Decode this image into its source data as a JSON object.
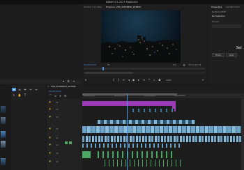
{
  "app": {
    "title": "BBNM 4-5-2023 MAKE4UA"
  },
  "source_panel": {
    "tabs": [
      "Source: (no clips)",
      "Program: V09_20180820_224502"
    ]
  },
  "program_monitor": {
    "timecode_left": "00;00;03;04",
    "fit": "Fit",
    "quality": "Full",
    "timecode_right": "00;12;04;18"
  },
  "properties_panel": {
    "tabs": [
      "Properties",
      "Lumetri Color"
    ],
    "sub_tabs": [
      "Selection",
      "Edit"
    ],
    "selection_label": "No Selection",
    "selected_label": "Sel",
    "field_label": "Project"
  },
  "effects_buttons": [
    "Emoji",
    "Crop"
  ],
  "timeline": {
    "tab_label": "V09_20180820_224502",
    "timecode": "00;00;03;04",
    "ruler_labels": [
      "00;00;00;00",
      "00;00;03;03",
      "00;00;06;06",
      "00;00;09;09"
    ],
    "tracks": [
      "V4",
      "V3",
      "V2",
      "V1",
      "A1",
      "A2",
      "A3",
      "A4"
    ]
  },
  "tools_panel": {
    "tools": [
      "selection-tool",
      "track-select-tool",
      "ripple-edit-tool",
      "razor-tool",
      "slip-tool",
      "pen-tool",
      "hand-tool",
      "type-tool"
    ]
  },
  "colors": {
    "accent_blue": "#4a90e2",
    "adjustment_clip": "#9b3bb5",
    "video_clip": "#6fa3c5",
    "audio_clip": "#4aa861"
  }
}
